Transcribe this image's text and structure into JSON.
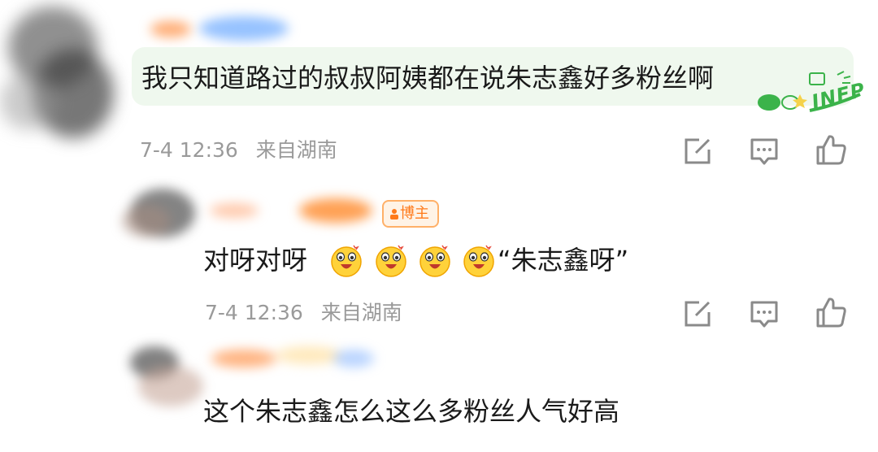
{
  "comments": [
    {
      "text": "我只知道路过的叔叔阿姨都在说朱志鑫好多粉丝啊",
      "date": "7-4 12:36",
      "source": "来自湖南",
      "tag": "INFP"
    },
    {
      "badge": "博主",
      "text": "对呀对呀",
      "emoji": [
        "grinning-face",
        "grinning-face",
        "grinning-face",
        "grinning-face"
      ],
      "quote": "“朱志鑫呀”",
      "date": "7-4 12:36",
      "source": "来自湖南"
    },
    {
      "text": "这个朱志鑫怎么这么多粉丝人气好高"
    }
  ],
  "icons": {
    "share": "share-edit-icon",
    "reply": "comment-icon",
    "like": "thumbs-up-icon"
  },
  "colors": {
    "bubble": "#eff8ee",
    "meta_text": "#9a9a9a",
    "badge": "#ff7a1a",
    "tag_green": "#3bb34a"
  }
}
